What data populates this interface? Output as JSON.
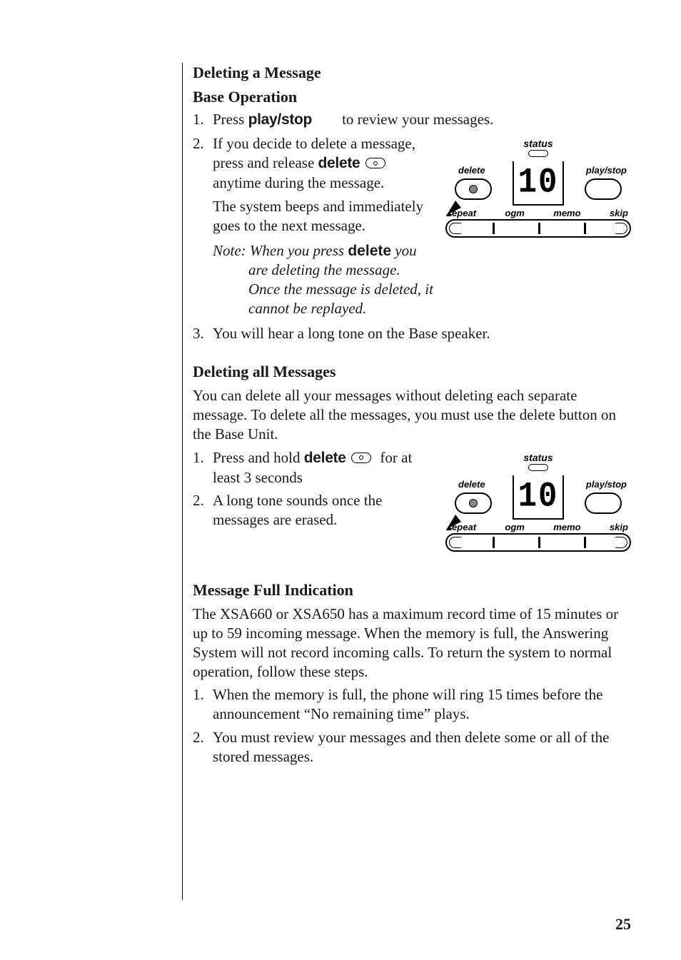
{
  "sec1": {
    "title": "Deleting a Message",
    "subtitle": "Base Operation",
    "step1_num": "1.",
    "step1_pre": "Press ",
    "step1_kw": "play/stop",
    "step1_post": " to review your messages.",
    "step2_num": "2.",
    "step2a_pre": "If you decide to delete a message, press and release ",
    "step2a_kw": "delete",
    "step2a_post": " anytime during the message.",
    "step2b": "The system beeps and immediately goes to the next message.",
    "note_label": "Note: ",
    "note_pre": "When you press ",
    "note_kw": "delete",
    "note_post": " you are deleting the message. Once the message is deleted, it cannot be replayed.",
    "step3_num": "3.",
    "step3": "You will hear a long tone on the Base speaker."
  },
  "sec2": {
    "title": "Deleting all Messages",
    "intro": "You can delete all your messages without deleting each separate message. To delete all the messages, you must use the delete button on the Base Unit.",
    "step1_num": "1.",
    "step1_pre": "Press and hold ",
    "step1_kw": "delete",
    "step1_post": " for at least 3 seconds",
    "step2_num": "2.",
    "step2": "A long tone sounds once the messages are erased."
  },
  "sec3": {
    "title": "Message Full Indication",
    "intro": "The XSA660 or XSA650 has a maximum record time of 15 minutes or up to 59 incoming message. When the memory is full, the Answering System will not record incoming calls. To return the system to normal operation, follow these steps.",
    "step1_num": "1.",
    "step1": "When the memory is full, the phone will ring 15 times before the announcement “No remaining time” plays.",
    "step2_num": "2.",
    "step2": "You must review your messages and then delete some or all of the stored messages."
  },
  "device": {
    "status": "status",
    "delete": "delete",
    "playstop": "play/stop",
    "display": "10",
    "repeat": "repeat",
    "ogm": "ogm",
    "memo": "memo",
    "skip": "skip"
  },
  "page_number": "25"
}
